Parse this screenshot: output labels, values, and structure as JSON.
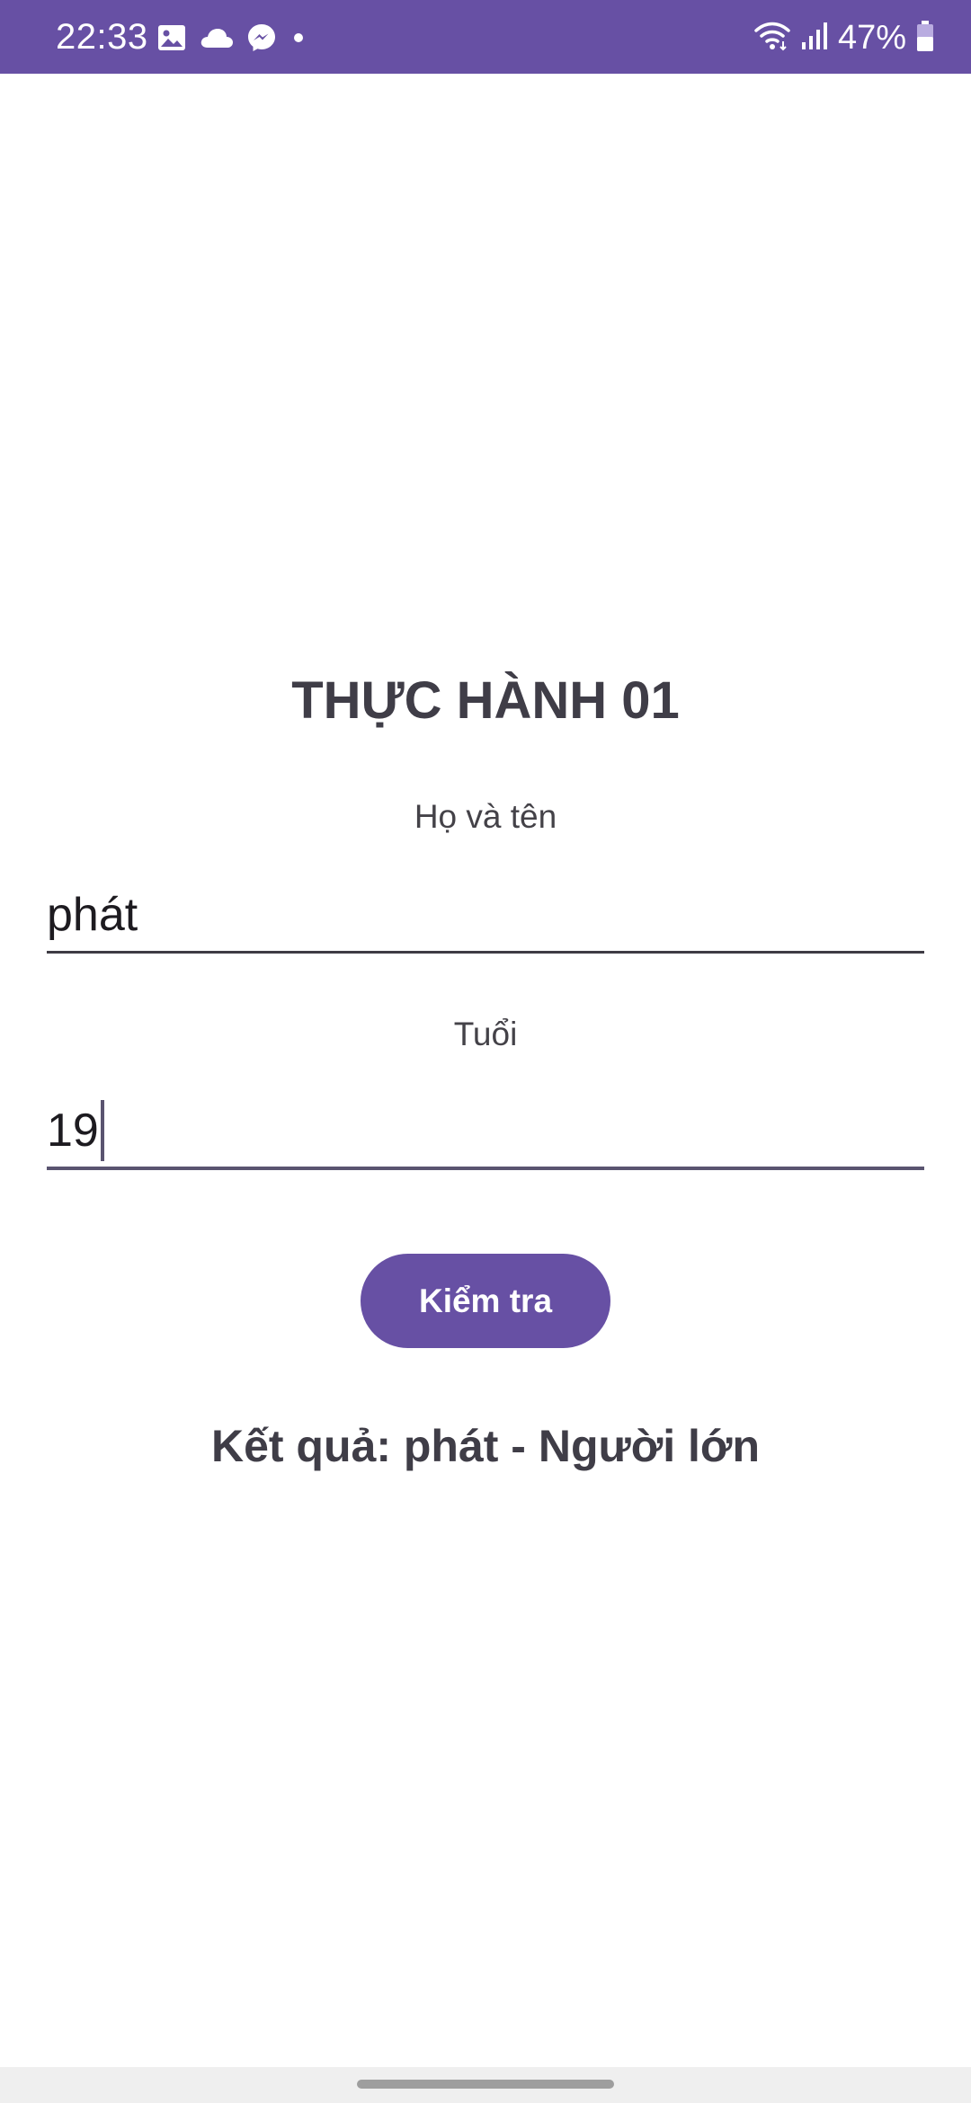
{
  "status_bar": {
    "time": "22:33",
    "battery_percent": "47%",
    "left_icons": [
      "gallery-icon",
      "cloud-icon",
      "messenger-icon",
      "dot-icon"
    ],
    "right_icons": [
      "wifi-icon",
      "signal-icon",
      "battery-icon"
    ],
    "accent_color": "#6750A4"
  },
  "main": {
    "title": "THỰC HÀNH 01",
    "name_label": "Họ và tên",
    "name_value": "phát",
    "age_label": "Tuổi",
    "age_value": "19",
    "check_button_label": "Kiểm tra",
    "result_text": "Kết quả: phát - Người lớn"
  }
}
